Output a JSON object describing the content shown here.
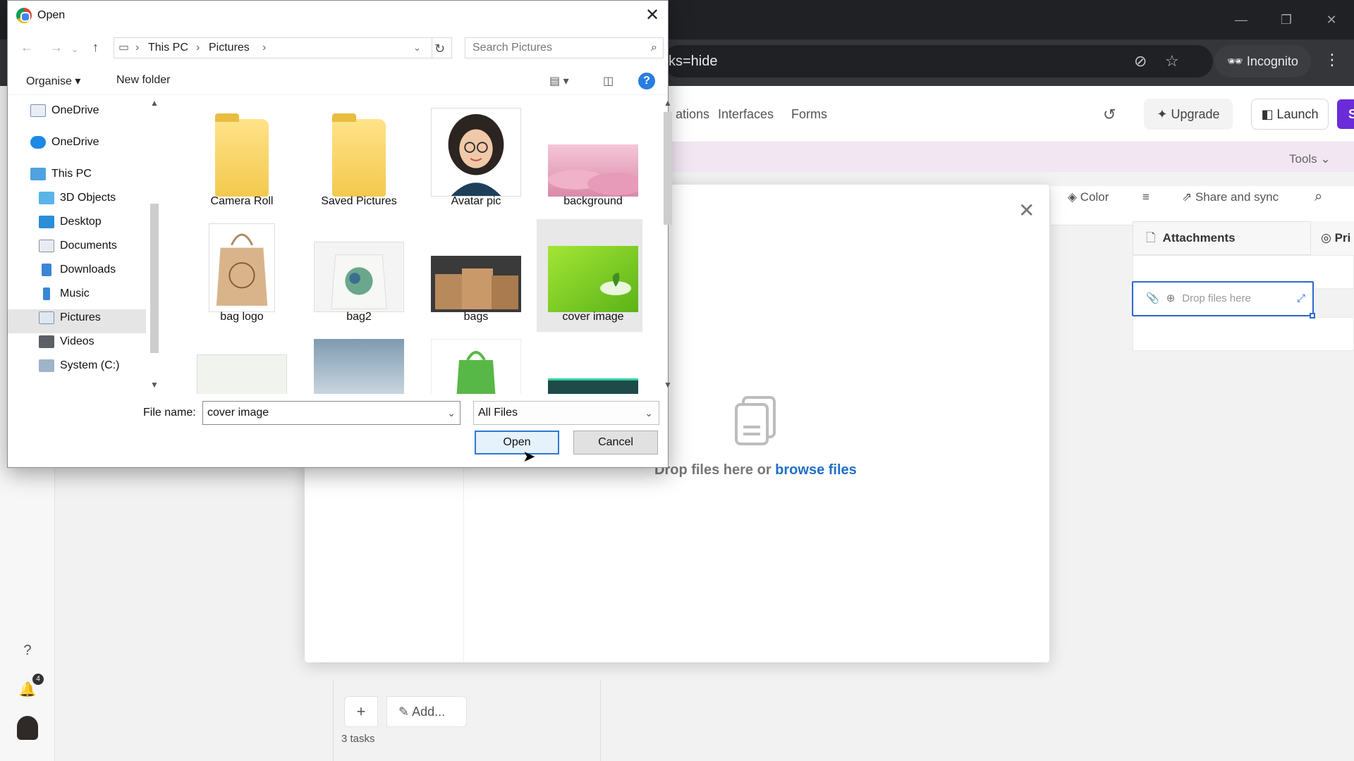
{
  "browser": {
    "url_fragment": "ks=hide",
    "incognito_label": "Incognito"
  },
  "app": {
    "nav_tabs": [
      "ations",
      "Interfaces",
      "Forms"
    ],
    "upgrade_label": "Upgrade",
    "launch_label": "Launch",
    "share_label": "Share",
    "tools_label": "Tools",
    "grid_tools": {
      "color": "Color",
      "share_sync": "Share and sync"
    },
    "columns": {
      "attachments": "Attachments",
      "pri": "Pri"
    },
    "drop_cell_text": "Drop files here",
    "add_label": "Add...",
    "tasks_count": "3 tasks",
    "notification_count": "4"
  },
  "modal": {
    "drop_text": "Drop files here or",
    "browse_link": "browse files"
  },
  "dialog": {
    "title": "Open",
    "breadcrumb": [
      "This PC",
      "Pictures"
    ],
    "search_placeholder": "Search Pictures",
    "organise": "Organise",
    "new_folder": "New folder",
    "nav_items": [
      {
        "label": "OneDrive",
        "icon": "onedrive-icon"
      },
      {
        "label": "OneDrive",
        "icon": "cloud-icon"
      },
      {
        "label": "This PC",
        "icon": "pc-icon"
      },
      {
        "label": "3D Objects",
        "icon": "cube-icon"
      },
      {
        "label": "Desktop",
        "icon": "desktop-icon"
      },
      {
        "label": "Documents",
        "icon": "documents-icon"
      },
      {
        "label": "Downloads",
        "icon": "download-icon"
      },
      {
        "label": "Music",
        "icon": "music-icon"
      },
      {
        "label": "Pictures",
        "icon": "pictures-icon"
      },
      {
        "label": "Videos",
        "icon": "videos-icon"
      },
      {
        "label": "System (C:)",
        "icon": "drive-icon"
      }
    ],
    "selected_nav": "Pictures",
    "files": [
      {
        "label": "Camera Roll",
        "kind": "folder"
      },
      {
        "label": "Saved Pictures",
        "kind": "folder"
      },
      {
        "label": "Avatar pic",
        "kind": "image"
      },
      {
        "label": "background",
        "kind": "image"
      },
      {
        "label": "bag logo",
        "kind": "image"
      },
      {
        "label": "bag2",
        "kind": "image"
      },
      {
        "label": "bags",
        "kind": "image"
      },
      {
        "label": "cover image",
        "kind": "image"
      }
    ],
    "selected_file": "cover image",
    "file_name_label": "File name:",
    "file_name_value": "cover image",
    "file_type": "All Files",
    "open_label": "Open",
    "cancel_label": "Cancel"
  },
  "colors": {
    "accent_purple": "#6a2bd8",
    "link_blue": "#1f6fc8",
    "selection_blue": "#2d68d1"
  }
}
